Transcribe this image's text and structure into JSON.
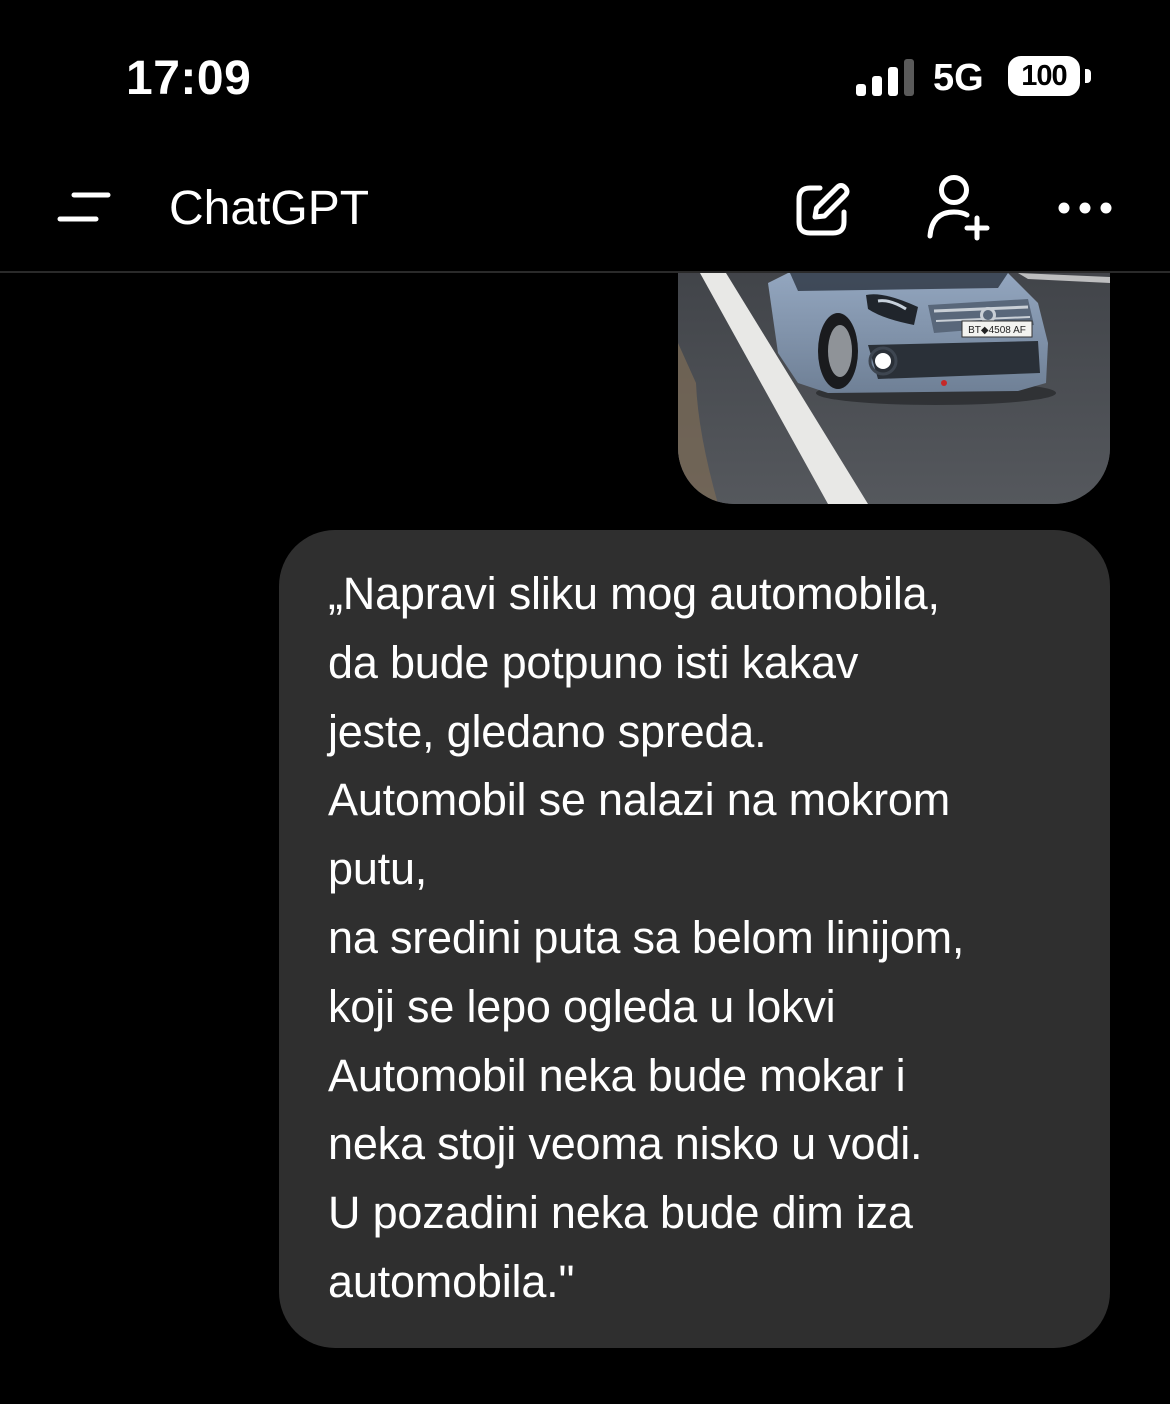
{
  "status_bar": {
    "time": "17:09",
    "network": "5G",
    "battery_level": "100",
    "signal_bars_active": 3,
    "signal_bars_total": 4
  },
  "header": {
    "title": "ChatGPT",
    "icons": [
      "menu-icon",
      "edit-icon",
      "add-user-icon",
      "more-icon"
    ]
  },
  "conversation": {
    "user_image": {
      "plate_text": "BT◆4508 AF"
    },
    "user_message": "„Napravi sliku mog automobila,\nda bude potpuno isti kakav\njeste, gledano spreda.\nAutomobil se nalazi na mokrom\nputu,\nna sredini puta sa belom linijom,\nkoji se lepo ogleda u lokvi\nAutomobil neka bude mokar i\nneka stoji veoma nisko u vodi.\nU pozadini neka bude dim iza\nautomobila.\""
  },
  "colors": {
    "background": "#000000",
    "bubble": "#2f2f2f",
    "text": "#ffffff",
    "divider": "#2a2a2a"
  }
}
